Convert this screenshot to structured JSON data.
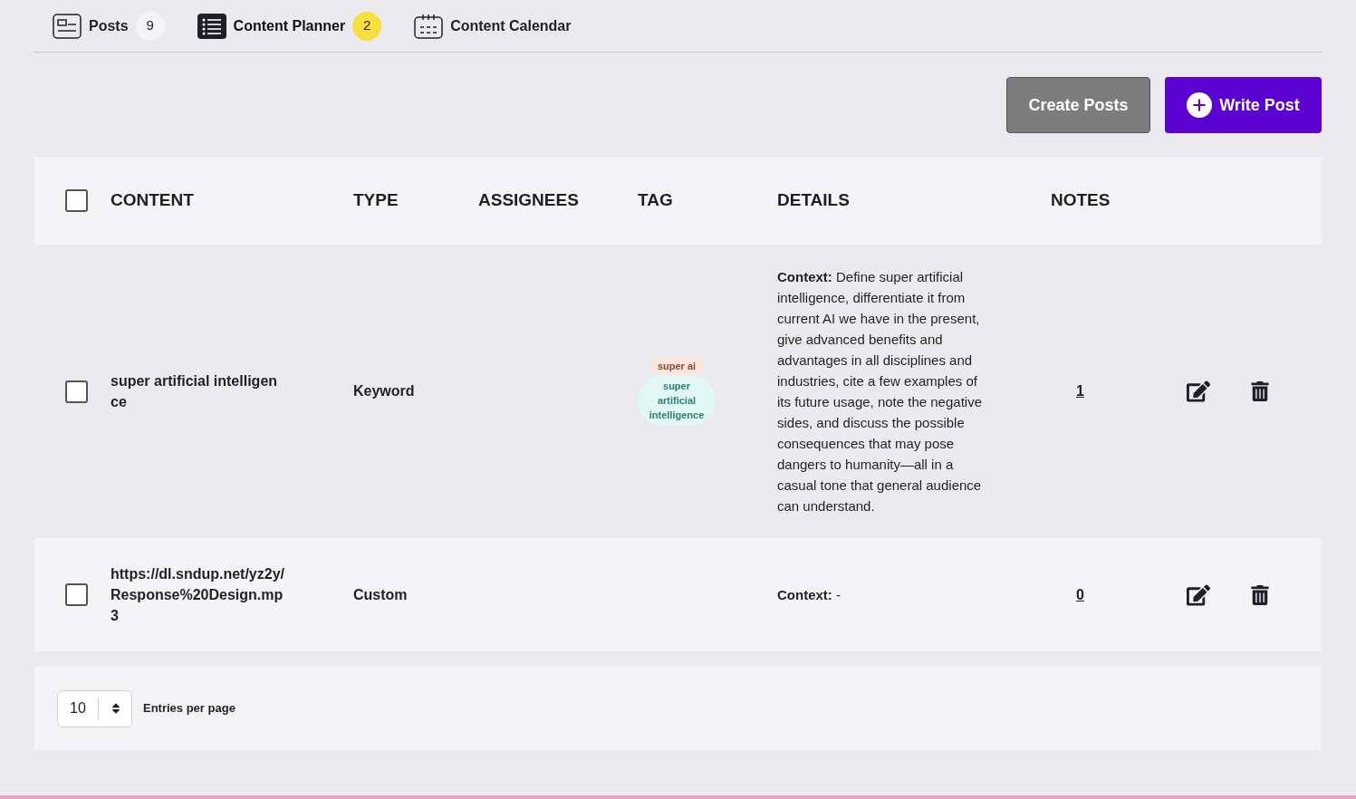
{
  "tabs": [
    {
      "label": "Posts",
      "badge": "9",
      "selected": false,
      "kind": "card"
    },
    {
      "label": "Content Planner",
      "badge": "2",
      "selected": true,
      "kind": "list"
    },
    {
      "label": "Content Calendar",
      "selected": false,
      "kind": "calendar"
    }
  ],
  "actions": {
    "create": "Create Posts",
    "write": "Write Post"
  },
  "table": {
    "select_all": {
      "checked": false
    },
    "columns": [
      "CONTENT",
      "TYPE",
      "ASSIGNEES",
      "TAG",
      "DETAILS",
      "NOTES"
    ],
    "rows": [
      {
        "checked": false,
        "content": "super artificial intelligence",
        "type": "Keyword",
        "tags": [
          {
            "label": "super ai",
            "color": "#fde5dc"
          },
          {
            "label": "super artificial intelligence",
            "color": "#e0f7f4"
          }
        ],
        "details": "**Context:** Define super artificial intelligence, differentiate it from current AI we have in the present, give advanced benefits and advantages in all disciplines and industries, cite a few examples of its future usage, note the negative sides, and discuss the possible consequences that may pose dangers to humanity—all in a casual tone that general audience can understand.",
        "notes": "1"
      },
      {
        "checked": false,
        "content": "https://dl.sndup.net/yz2y/Response%20Design.mp3",
        "type": "Custom",
        "tags": [],
        "details": "**Context:** -",
        "notes": "0"
      }
    ]
  },
  "pagination": {
    "per_page": "10",
    "label": "Entries per page"
  }
}
